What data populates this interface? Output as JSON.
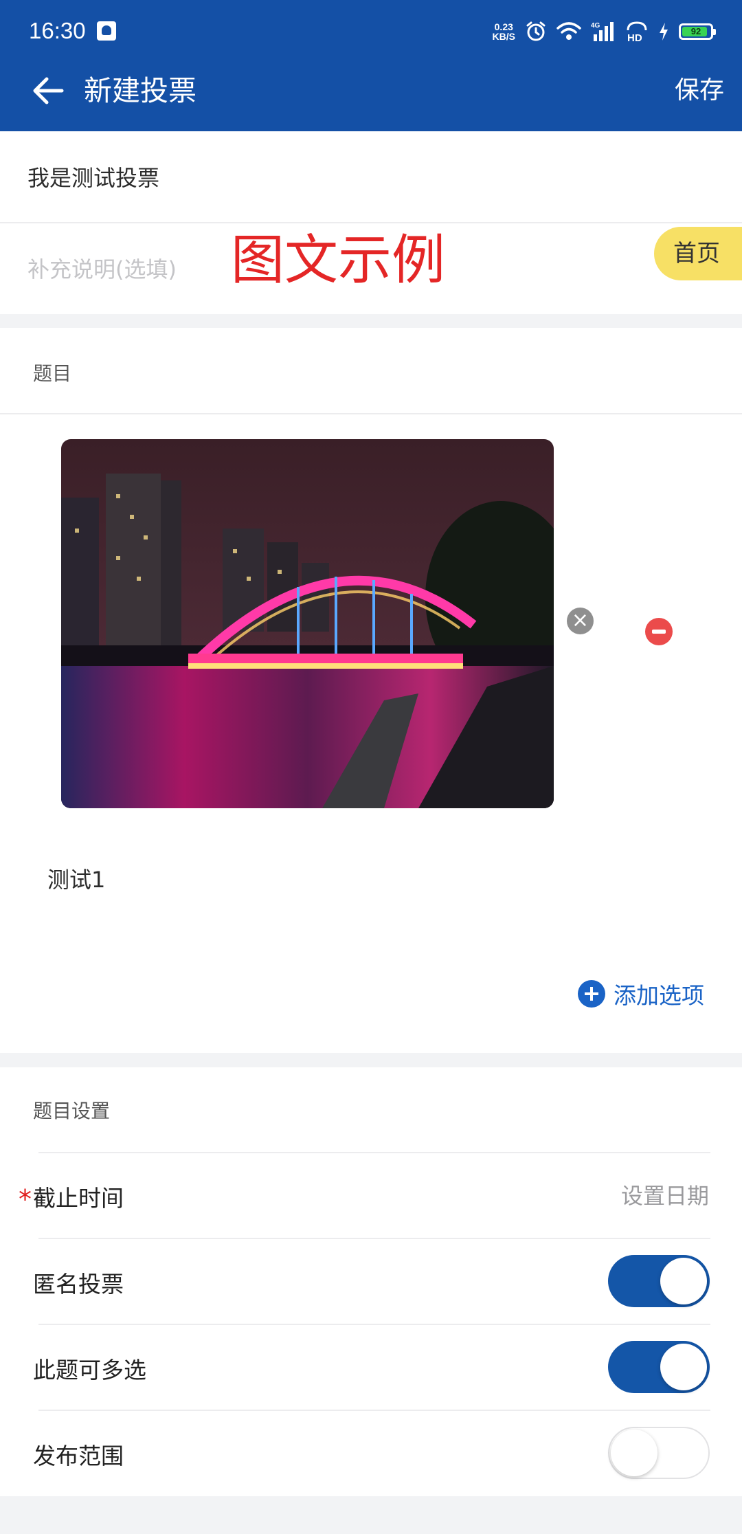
{
  "status_bar": {
    "time": "16:30",
    "net_speed_value": "0.23",
    "net_speed_unit": "KB/S",
    "network_type": "4G",
    "hd_label": "HD",
    "battery": "92",
    "battery_level": 0.92,
    "battery_color": "#39d353"
  },
  "header": {
    "title": "新建投票",
    "save_label": "保存",
    "color": "#1450a6"
  },
  "form": {
    "title_value": "我是测试投票",
    "desc_placeholder": "补充说明(选填)"
  },
  "question": {
    "section_label": "题目",
    "image_alt": "photo of illuminated arch bridge at night",
    "options": [
      {
        "text": "测试1"
      }
    ],
    "add_option_label": "添加选项",
    "accent_color": "#1a63c6"
  },
  "settings": {
    "section_label": "题目设置",
    "deadline_label": "截止时间",
    "required_mark": "*",
    "deadline_placeholder": "设置日期",
    "anonymous_label": "匿名投票",
    "anonymous_on": true,
    "multi_select_label": "此题可多选",
    "multi_select_on": true,
    "scope_label": "发布范围",
    "scope_on": false
  },
  "overlay": {
    "watermark_text": "图文示例",
    "home_badge_label": "首页"
  }
}
